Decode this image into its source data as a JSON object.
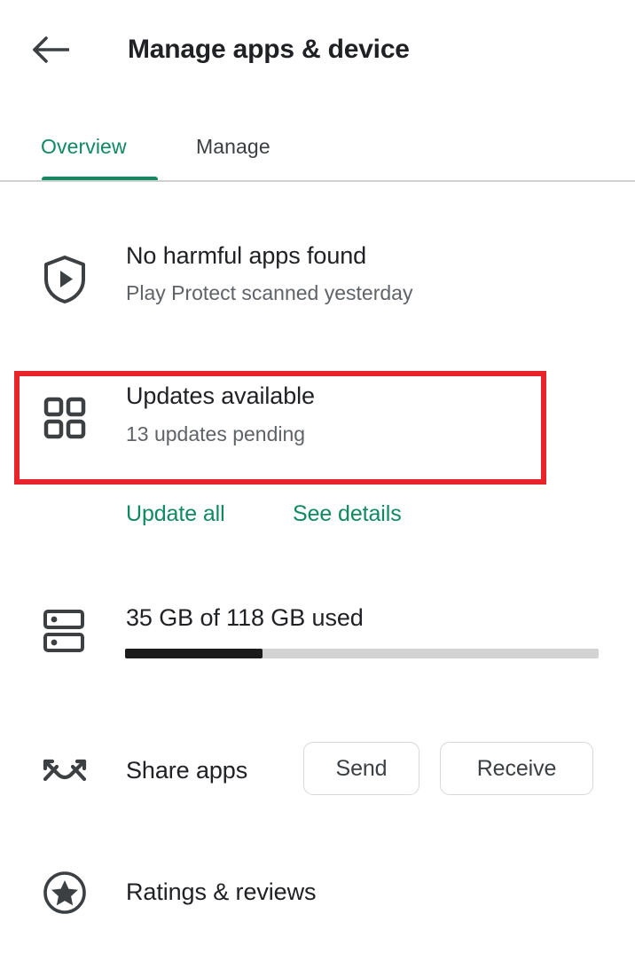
{
  "appbar": {
    "back_icon": "arrow-left-icon",
    "title": "Manage apps & device"
  },
  "tabs": {
    "items": [
      {
        "label": "Overview",
        "selected": true
      },
      {
        "label": "Manage",
        "selected": false
      }
    ],
    "active_color": "#0f8a5f",
    "inactive_color": "#3c4043"
  },
  "sections": {
    "play_protect": {
      "icon": "shield-play-icon",
      "title": "No harmful apps found",
      "subtitle": "Play Protect scanned yesterday"
    },
    "updates": {
      "icon": "apps-grid-icon",
      "title": "Updates available",
      "subtitle": "13 updates pending",
      "update_all_label": "Update all",
      "see_details_label": "See details",
      "highlight_color": "#e8232a"
    },
    "storage": {
      "icon": "storage-drive-icon",
      "title": "35 GB of 118 GB used",
      "used_gb": 35,
      "total_gb": 118,
      "percent_used": 29,
      "fill_color": "#1b1b1b",
      "track_color": "#d3d3d3"
    },
    "share_apps": {
      "icon": "nearby-share-icon",
      "title": "Share apps",
      "send_label": "Send",
      "receive_label": "Receive"
    },
    "ratings": {
      "icon": "star-circle-icon",
      "title": "Ratings & reviews"
    }
  }
}
